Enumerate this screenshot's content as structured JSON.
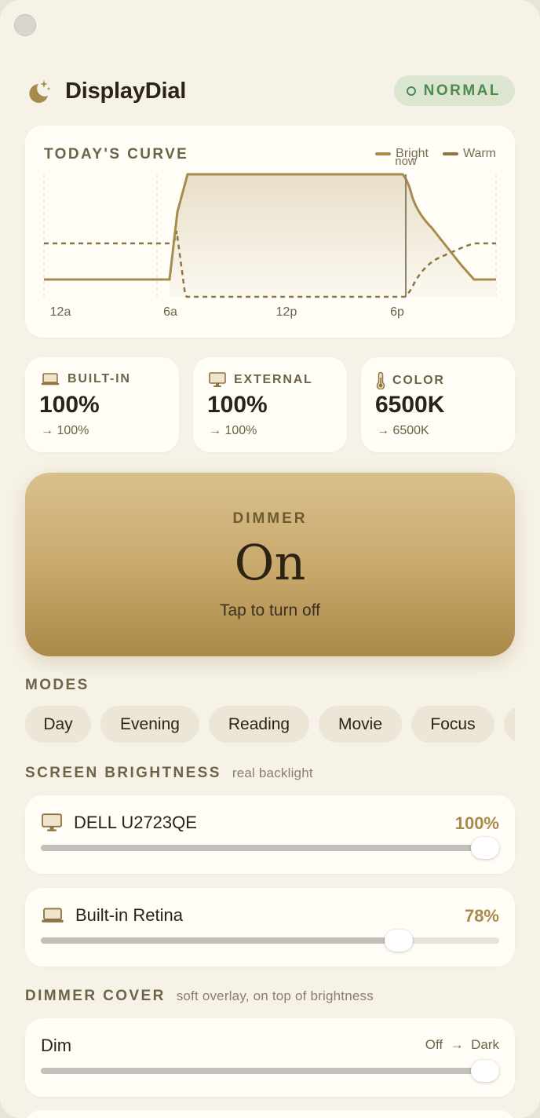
{
  "app": {
    "title": "DisplayDial",
    "status": "NORMAL"
  },
  "curve": {
    "title": "TODAY'S CURVE",
    "legend": [
      {
        "name": "Bright",
        "color": "#a78b4e",
        "style": "solid"
      },
      {
        "name": "Warm",
        "color": "#8f7443",
        "style": "solid"
      }
    ],
    "x_ticks": [
      "12a",
      "6a",
      "12p",
      "6p"
    ],
    "now_label": "now"
  },
  "stats": [
    {
      "icon": "laptop-icon",
      "label": "BUILT-IN",
      "value": "100%",
      "target": "→ 100%"
    },
    {
      "icon": "monitor-icon",
      "label": "EXTERNAL",
      "value": "100%",
      "target": "→ 100%"
    },
    {
      "icon": "thermometer-icon",
      "label": "COLOR",
      "value": "6500K",
      "target": "→ 6500K"
    }
  ],
  "dimmer": {
    "label": "DIMMER",
    "state": "On",
    "hint": "Tap to turn off"
  },
  "modes": {
    "label": "MODES",
    "items": [
      "Day",
      "Evening",
      "Reading",
      "Movie",
      "Focus"
    ]
  },
  "brightness": {
    "label": "SCREEN BRIGHTNESS",
    "note": "real backlight",
    "displays": [
      {
        "icon": "monitor-icon",
        "name": "DELL U2723QE",
        "value_text": "100%",
        "level": 1.0
      },
      {
        "icon": "laptop-icon",
        "name": "Built-in Retina",
        "value_text": "78%",
        "level": 0.78
      }
    ]
  },
  "cover": {
    "label": "DIMMER COVER",
    "note": "soft overlay, on top of brightness",
    "slider": {
      "name": "Dim",
      "range_from": "Off",
      "range_to": "Dark",
      "level": 1.0
    }
  },
  "colors": {
    "accent": "#a78b4e",
    "status_green": "#4c8a4e",
    "status_bg": "#dce5d0",
    "background": "#f6f2e8"
  }
}
